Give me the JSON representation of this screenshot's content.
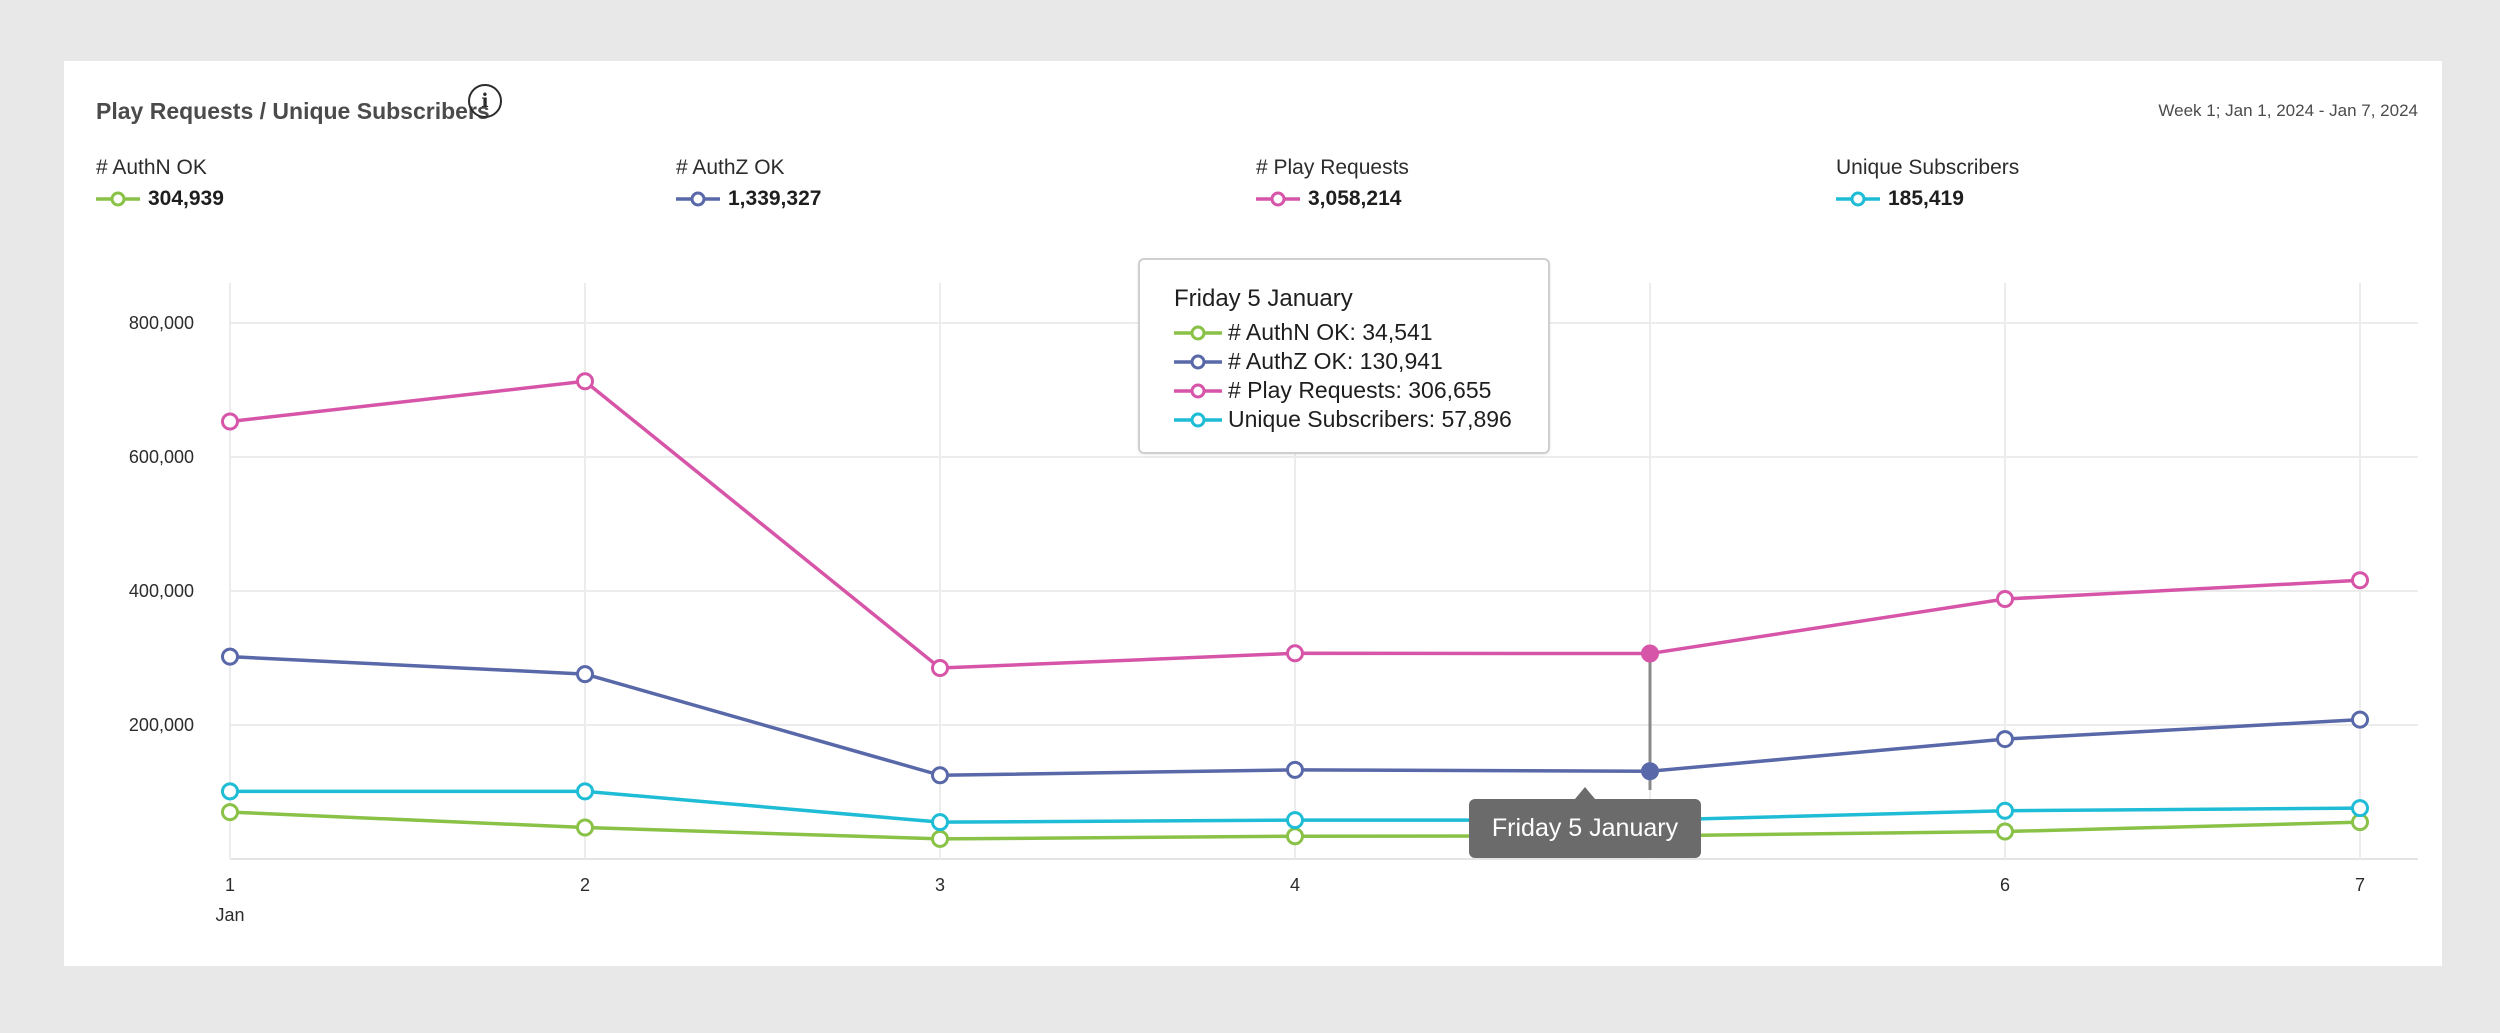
{
  "card": {
    "title": "Play Requests / Unique Subscribers",
    "info_icon": "info-icon",
    "date_range": "Week 1; Jan 1, 2024 - Jan 7, 2024"
  },
  "legend": [
    {
      "label": "# AuthN OK",
      "total": "304,939",
      "color": "#8ac147"
    },
    {
      "label": "# AuthZ OK",
      "total": "1,339,327",
      "color": "#5968a8"
    },
    {
      "label": "# Play Requests",
      "total": "3,058,214",
      "color": "#d755a8"
    },
    {
      "label": "Unique Subscribers",
      "total": "185,419",
      "color": "#1fbcd6"
    }
  ],
  "tooltip": {
    "title": "Friday 5 January",
    "rows": [
      {
        "text": "# AuthN OK: 34,541",
        "color": "#8ac147"
      },
      {
        "text": "# AuthZ OK: 130,941",
        "color": "#5968a8"
      },
      {
        "text": "# Play Requests: 306,655",
        "color": "#d755a8"
      },
      {
        "text": "Unique Subscribers: 57,896",
        "color": "#1fbcd6"
      }
    ]
  },
  "crosshair_label": "Friday 5 January",
  "chart_data": {
    "type": "line",
    "x": [
      1,
      2,
      3,
      4,
      5,
      6,
      7
    ],
    "x_tick_labels": [
      "1",
      "2",
      "3",
      "4",
      "",
      "6",
      "7"
    ],
    "x_sub_label": "Jan",
    "y_ticks": [
      200000,
      400000,
      600000,
      800000
    ],
    "y_tick_labels": [
      "200,000",
      "400,000",
      "600,000",
      "800,000"
    ],
    "ylim": [
      0,
      855000
    ],
    "grid": true,
    "highlighted_x": 5,
    "series": [
      {
        "name": "# AuthN OK",
        "color": "#8ac147",
        "values": [
          70000,
          47000,
          30000,
          34000,
          34541,
          41000,
          55000
        ]
      },
      {
        "name": "# AuthZ OK",
        "color": "#5968a8",
        "values": [
          302000,
          276000,
          125000,
          133000,
          130941,
          179000,
          208000
        ]
      },
      {
        "name": "# Play Requests",
        "color": "#d755a8",
        "values": [
          653000,
          713000,
          285000,
          307000,
          306655,
          388000,
          416000
        ]
      },
      {
        "name": "Unique Subscribers",
        "color": "#1fbcd6",
        "values": [
          101000,
          101000,
          55000,
          58000,
          57896,
          72000,
          76000
        ]
      }
    ]
  }
}
